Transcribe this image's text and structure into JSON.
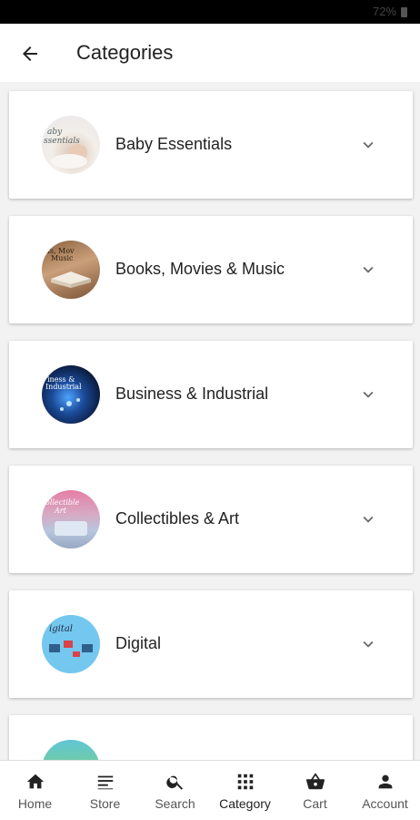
{
  "status_bar": {
    "battery": "72%"
  },
  "app_bar": {
    "title": "Categories"
  },
  "categories": [
    {
      "label": "Baby Essentials",
      "thumb_text": "Baby Essentials",
      "thumb_colors": [
        "#f3eee9",
        "#c7b2a0"
      ]
    },
    {
      "label": "Books, Movies & Music",
      "thumb_text": "Books, Movies & Music",
      "thumb_colors": [
        "#b9885a",
        "#6e4b33"
      ]
    },
    {
      "label": "Business & Industrial",
      "thumb_text": "Business & Industrial",
      "thumb_colors": [
        "#0d1d3b",
        "#3a8ed8"
      ]
    },
    {
      "label": "Collectibles & Art",
      "thumb_text": "Collectibles & Art",
      "thumb_colors": [
        "#e27fa4",
        "#b9c8df"
      ]
    },
    {
      "label": "Digital",
      "thumb_text": "Digital",
      "thumb_colors": [
        "#74c7ee",
        "#d9434a"
      ]
    },
    {
      "label": "",
      "thumb_text": "",
      "thumb_colors": [
        "#5fc6d6",
        "#8bd35b"
      ]
    }
  ],
  "bottom_nav": [
    {
      "label": "Home",
      "icon": "home-icon"
    },
    {
      "label": "Store",
      "icon": "store-icon"
    },
    {
      "label": "Search",
      "icon": "search-icon"
    },
    {
      "label": "Category",
      "icon": "category-grid-icon"
    },
    {
      "label": "Cart",
      "icon": "cart-basket-icon"
    },
    {
      "label": "Account",
      "icon": "account-icon"
    }
  ],
  "colors": {
    "text": "#222222",
    "muted": "#555555",
    "background": "#f2f2f2"
  }
}
